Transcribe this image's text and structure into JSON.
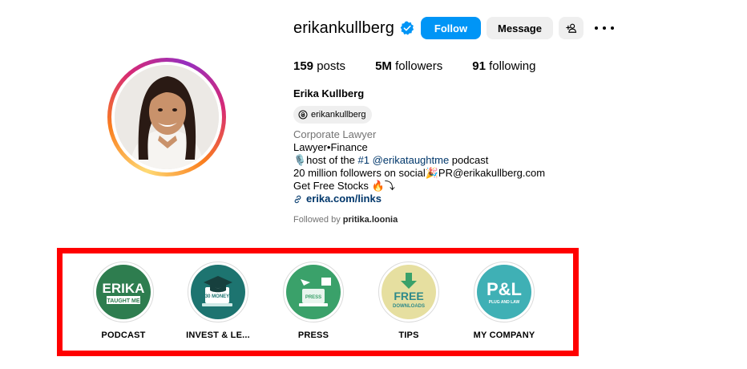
{
  "profile": {
    "username": "erikankullberg",
    "follow_label": "Follow",
    "message_label": "Message",
    "stats": {
      "posts_count": "159",
      "posts_label": "posts",
      "followers_count": "5M",
      "followers_label": "followers",
      "following_count": "91",
      "following_label": "following"
    },
    "full_name": "Erika Kullberg",
    "threads_handle": "erikankullberg",
    "bio": {
      "category": "Corporate Lawyer",
      "line1": "Lawyer•Finance",
      "line2_prefix": "🎙️host of the ",
      "line2_hashtag": "#1",
      "line2_mention": "@erikataughtme",
      "line2_suffix": " podcast",
      "line3": "20 million followers on social🎉PR@erikakullberg.com",
      "line4": "Get Free Stocks 🔥⤵",
      "link": "erika.com/links"
    },
    "followed_by_prefix": "Followed by ",
    "followed_by_user": "pritika.loonia"
  },
  "highlights": [
    {
      "label": "PODCAST",
      "cover_text_1": "ERIKA",
      "cover_text_2": "TAUGHT ME",
      "color": "#2e7d4f"
    },
    {
      "label": "INVEST & LE...",
      "cover_text_1": "30 MONEY",
      "color": "#1d7470"
    },
    {
      "label": "PRESS",
      "cover_text_1": "PRESS",
      "color": "#3aa16a"
    },
    {
      "label": "TIPS",
      "cover_text_1": "FREE",
      "cover_text_2": "DOWNLOADS",
      "color": "#e6dfa0"
    },
    {
      "label": "MY COMPANY",
      "cover_text_1": "P&L",
      "cover_text_2": "PLUG AND LAW",
      "color": "#3fb0b5"
    }
  ],
  "colors": {
    "follow_blue": "#0095f6",
    "verified_blue": "#0095f6",
    "highlight_box_border": "#ff0000",
    "link_blue": "#00376b"
  }
}
